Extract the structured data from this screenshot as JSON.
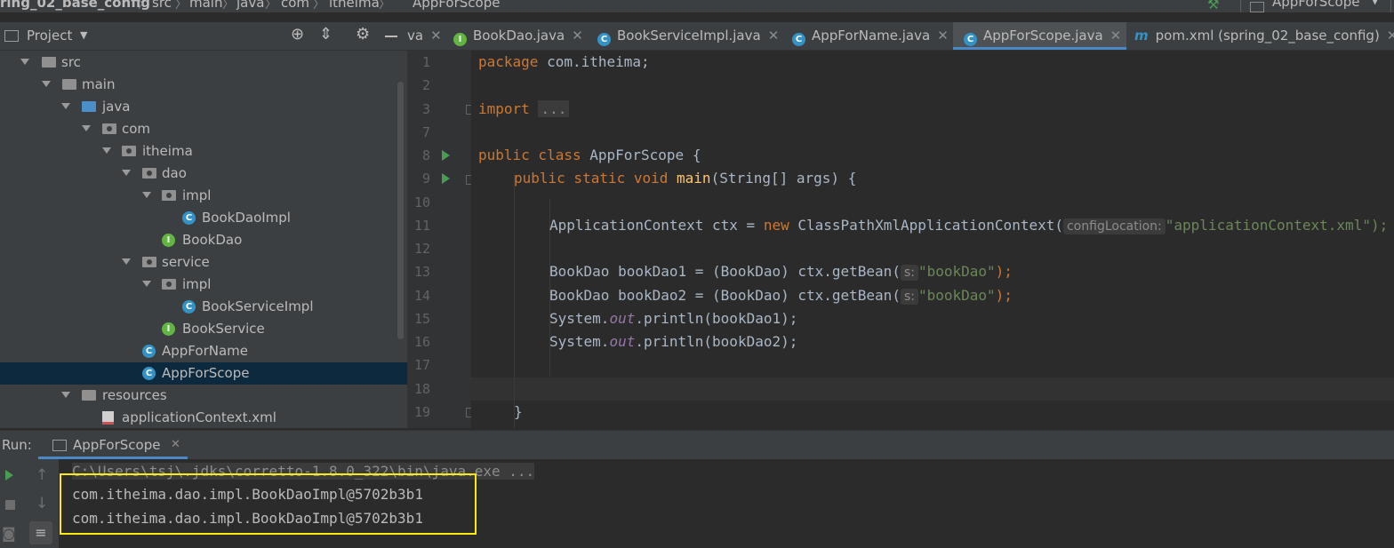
{
  "breadcrumb": [
    "ring_02_base_config",
    "src",
    "main",
    "java",
    "com",
    "itheima",
    "AppForScope"
  ],
  "run_config": "AppForScope",
  "project_panel": {
    "title": "Project"
  },
  "tree": [
    {
      "label": "src"
    },
    {
      "label": "main"
    },
    {
      "label": "java"
    },
    {
      "label": "com"
    },
    {
      "label": "itheima"
    },
    {
      "label": "dao"
    },
    {
      "label": "impl"
    },
    {
      "label": "BookDaoImpl"
    },
    {
      "label": "BookDao"
    },
    {
      "label": "service"
    },
    {
      "label": "impl"
    },
    {
      "label": "BookServiceImpl"
    },
    {
      "label": "BookService"
    },
    {
      "label": "AppForName"
    },
    {
      "label": "AppForScope"
    },
    {
      "label": "resources"
    },
    {
      "label": "applicationContext.xml"
    }
  ],
  "tabs": [
    {
      "label": "va"
    },
    {
      "label": "BookDao.java"
    },
    {
      "label": "BookServiceImpl.java"
    },
    {
      "label": "AppForName.java"
    },
    {
      "label": "AppForScope.java"
    },
    {
      "label": "pom.xml (spring_02_base_config)"
    }
  ],
  "editor": {
    "line_numbers": [
      "1",
      "2",
      "3",
      "7",
      "8",
      "9",
      "10",
      "11",
      "12",
      "13",
      "14",
      "15",
      "16",
      "17",
      "18",
      "19"
    ],
    "code": {
      "l1_kw": "package",
      "l1_rest": " com.itheima;",
      "l3_kw": "import",
      "l3_folded": "...",
      "l8_kw": "public class",
      "l8_rest": " AppForScope {",
      "l9_kw": "public static void",
      "l9_fn": "main",
      "l9_rest": "(String[] args) {",
      "l11_a": "ApplicationContext ctx = ",
      "l11_new": "new",
      "l11_b": " ClassPathXmlApplicationContext(",
      "l11_hint": "configLocation:",
      "l11_str": "\"applicationContext.xml\");",
      "l13_a": "BookDao bookDao1 = (BookDao) ctx.getBean(",
      "l13_hint": "s:",
      "l13_str": "\"bookDao\"",
      "l13_end": ");",
      "l14_a": "BookDao bookDao2 = (BookDao) ctx.getBean(",
      "l14_hint": "s:",
      "l14_str": "\"bookDao\"",
      "l14_end": ");",
      "l15_a": "System.",
      "l15_out": "out",
      "l15_b": ".println(bookDao1);",
      "l16_a": "System.",
      "l16_out": "out",
      "l16_b": ".println(bookDao2);",
      "l19": "}"
    }
  },
  "run_panel": {
    "label": "Run:",
    "tab": "AppForScope",
    "console": [
      "C:\\Users\\tsj\\.jdks\\corretto-1.8.0_322\\bin\\java.exe ...",
      "com.itheima.dao.impl.BookDaoImpl@5702b3b1",
      "com.itheima.dao.impl.BookDaoImpl@5702b3b1"
    ]
  }
}
